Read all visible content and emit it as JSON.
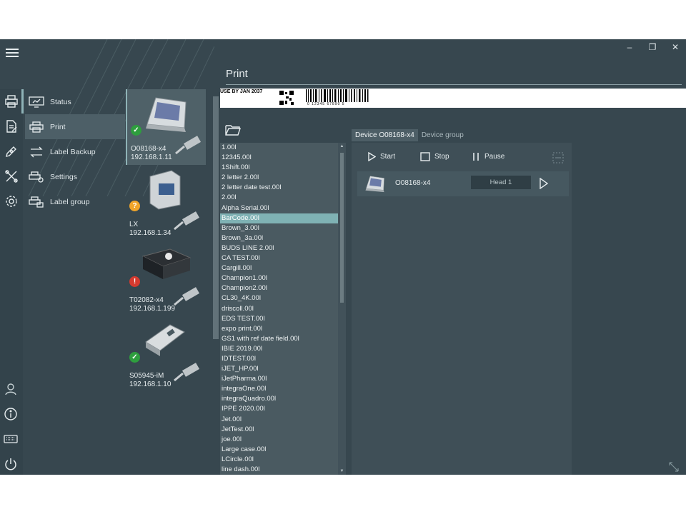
{
  "window": {
    "controls": [
      "–",
      "❐",
      "✕"
    ]
  },
  "page": {
    "title": "Print"
  },
  "nav": {
    "items": [
      {
        "label": "Status",
        "icon": "monitor-icon"
      },
      {
        "label": "Print",
        "icon": "printer-icon"
      },
      {
        "label": "Label Backup",
        "icon": "swap-arrows-icon"
      },
      {
        "label": "Settings",
        "icon": "printer-gear-icon"
      },
      {
        "label": "Label group",
        "icon": "printer-stack-icon"
      }
    ]
  },
  "devices": [
    {
      "name": "O08168-x4",
      "ip": "192.168.1.11",
      "status": "ok",
      "status_glyph": "✓",
      "status_color": "#2e9e3e"
    },
    {
      "name": "LX",
      "ip": "192.168.1.34",
      "status": "unknown",
      "status_glyph": "?",
      "status_color": "#f0a52a"
    },
    {
      "name": "T02082-x4",
      "ip": "192.168.1.199",
      "status": "error",
      "status_glyph": "!",
      "status_color": "#d63a2f"
    },
    {
      "name": "S05945-iM",
      "ip": "192.168.1.10",
      "status": "ok",
      "status_glyph": "✓",
      "status_color": "#2e9e3e"
    }
  ],
  "preview": {
    "text": "USE BY JAN 2037",
    "barcode_digits": "0  12345  67890  5"
  },
  "files": {
    "selected": "BarCode.00l",
    "items": [
      "1.00l",
      "12345.00l",
      "1Shift.00l",
      "2 letter 2.00l",
      "2 letter date test.00l",
      "2.00l",
      "Alpha Serial.00l",
      "BarCode.00l",
      "Brown_3.00l",
      "Brown_3a.00l",
      "BUDS LINE 2.00l",
      "CA TEST.00l",
      "Cargill.00l",
      "Champion1.00l",
      "Champion2.00l",
      "CL30_4K.00l",
      "driscoll.00l",
      "EDS TEST.00l",
      "expo print.00l",
      "GS1 with ref date field.00l",
      "IBIE 2019.00l",
      "IDTEST.00l",
      "iJET_HP.00l",
      "iJetPharma.00l",
      "integraOne.00l",
      "integraQuadro.00l",
      "IPPE 2020.00l",
      "Jet.00l",
      "JetTest.00l",
      "joe.00l",
      "Large case.00l",
      "LCircle.00l",
      "line dash.00l"
    ]
  },
  "tabs": [
    {
      "label": "Device O08168-x4",
      "active": true
    },
    {
      "label": "Device group",
      "active": false
    }
  ],
  "toolbar": {
    "start": "Start",
    "stop": "Stop",
    "pause": "Pause"
  },
  "device_row": {
    "name": "O08168-x4",
    "head": "Head 1"
  },
  "colors": {
    "background": "#37474f",
    "accent": "#7fb2b4",
    "panel": "#3f4f57"
  }
}
